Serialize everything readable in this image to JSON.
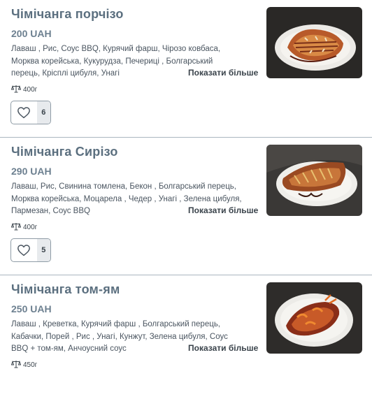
{
  "items": [
    {
      "title": "Чімічанга порчізо",
      "price": "200 UAH",
      "ingredients": "Лаваш , Рис, Соус BBQ, Курячий фарш, Чірозо ковбаса, Морква корейська, Кукурудза, Печериці , Болгарський перець, Крісплі цибуля, Унагі",
      "more_label": "Показати більше",
      "weight": "400г",
      "likes": "6"
    },
    {
      "title": "Чімічанга Сирізо",
      "price": "290 UAH",
      "ingredients": "Лаваш, Рис, Свинина томлена, Бекон , Болгарський перець, Морква корейська, Моцарела , Чедер , Унагі , Зелена цибуля, Пармезан, Соус BBQ",
      "more_label": "Показати більше",
      "weight": "400г",
      "likes": "5"
    },
    {
      "title": "Чімічанга том-ям",
      "price": "250 UAH",
      "ingredients": "Лаваш , Креветка, Курячий фарш , Болгарський перець, Кабачки, Порей , Рис , Унагі, Кунжут, Зелена цибуля, Соус BBQ + том-ям, Анчоусний соус",
      "more_label": "Показати більше",
      "weight": "450г",
      "likes": ""
    }
  ],
  "colors": {
    "title": "#5b6f7f",
    "price": "#6d8090",
    "divider": "#aab6c0",
    "like_count_bg": "#e7eaed"
  },
  "icons": {
    "weight": "scale-icon",
    "like": "heart-icon"
  }
}
